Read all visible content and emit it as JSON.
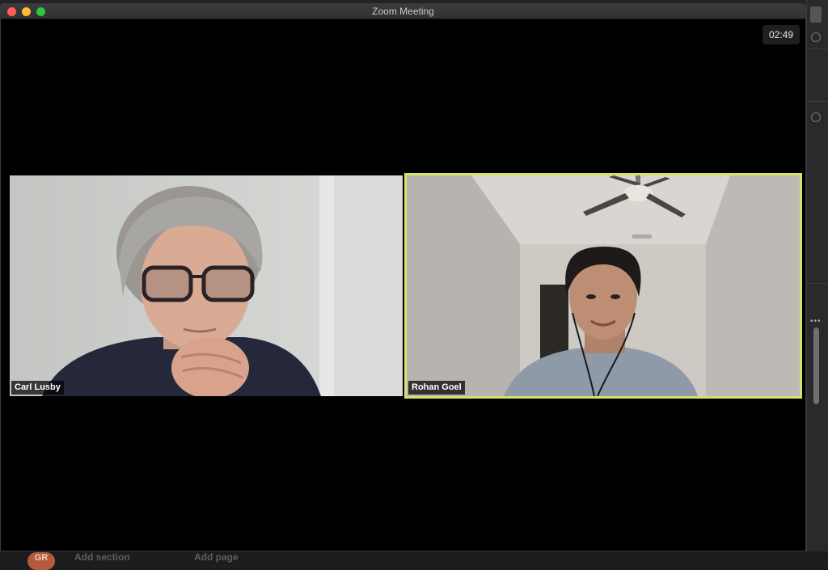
{
  "window": {
    "title": "Zoom Meeting"
  },
  "meeting": {
    "elapsed_time": "02:49",
    "participants": [
      {
        "name": "Carl Lusby",
        "active_speaker": false
      },
      {
        "name": "Rohan Goel",
        "active_speaker": true
      }
    ]
  },
  "background_app": {
    "avatar_initials": "GR",
    "add_section_label": "Add section",
    "add_page_label": "Add page"
  },
  "colors": {
    "active_speaker_border": "#d8e06a",
    "close": "#fe5f57",
    "minimize": "#febc2e",
    "maximize": "#28c840"
  }
}
